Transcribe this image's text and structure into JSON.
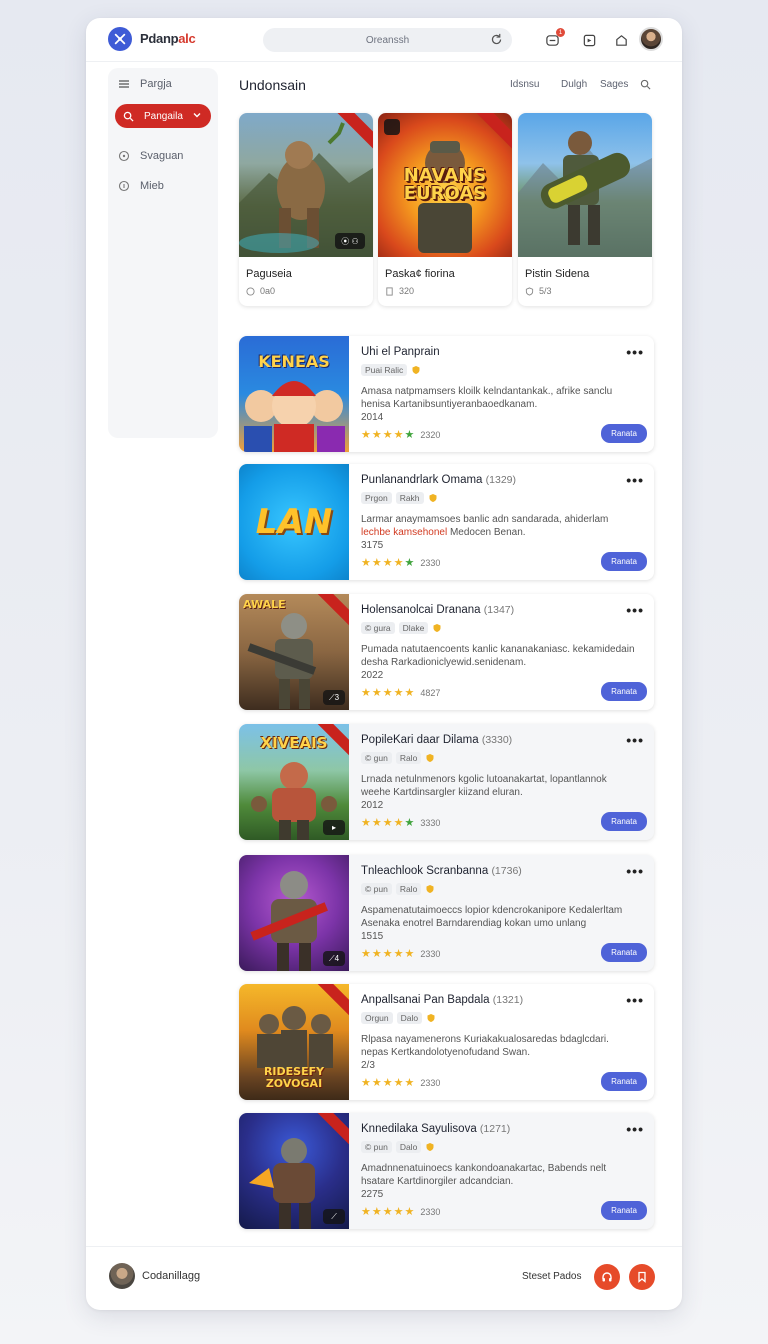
{
  "header": {
    "brand_main": "Pdanp",
    "brand_accent": "alc",
    "search_placeholder": "Oreanssh",
    "notif_count": "1"
  },
  "sidebar": {
    "items": [
      {
        "label": "Pargja",
        "icon": "menu-icon"
      },
      {
        "label": "Pangaila",
        "icon": "search-icon"
      },
      {
        "label": "Svaguan",
        "icon": "chat-icon"
      },
      {
        "label": "Mieb",
        "icon": "info-icon"
      }
    ]
  },
  "main": {
    "title": "Undonsain",
    "links": [
      "Idsnsu",
      "Dulgh",
      "Sages"
    ]
  },
  "featured": [
    {
      "title": "Paguseia",
      "meta": "0a0",
      "chip": "⦿ ⚇"
    },
    {
      "title": "Paska¢ fiorina",
      "meta": "320",
      "art_text": "NAVANS EUROAS"
    },
    {
      "title": "Pistin Sidena",
      "meta": "5/3"
    }
  ],
  "rows": [
    {
      "title": "Uhi el Panprain",
      "year": "",
      "tags": [
        "Puai Ralic"
      ],
      "desc_a": "Amasa natpmamsers kloilk kelndantankak., afrike sanclu henisa Kartanibsuntiyeranbaoedkanam.",
      "desc_hl": "",
      "desc_b": "",
      "year_line": "2014",
      "rating_green": 1,
      "count": "2320",
      "button": "Ranata",
      "art_text": "KENEAS"
    },
    {
      "title": "Punlanandrlark Omama",
      "year": "(1329)",
      "tags": [
        "Prgon",
        "Rakh"
      ],
      "desc_a": "Larmar anaymamsoes banlic adn sandarada, ahiderlam",
      "desc_hl": "lechbe kamsehonel",
      "desc_b": "Medocen Benan.",
      "year_line": "3175",
      "rating_green": 1,
      "count": "2330",
      "button": "Ranata",
      "art_text": "LAN"
    },
    {
      "title": "Holensanolcai Dranana",
      "year": "(1347)",
      "tags": [
        "© gura",
        "Dlake"
      ],
      "desc_a": "Pumada natutaencoents kanlic kananakaniasc. kekamidedain desha Rarkadioniclyewid.senidenam.",
      "desc_hl": "",
      "desc_b": "",
      "year_line": "2022",
      "rating_green": 0,
      "count": "4827",
      "button": "Ranata",
      "art_text": "AWALE"
    },
    {
      "title": "PopileKari daar Dilama",
      "year": "(3330)",
      "tags": [
        "© gun",
        "Ralo"
      ],
      "desc_a": "Lrnada netulnmenors kgolic lutoanakartat, lopantlannok weehe Kartdinsargler kiizand eluran.",
      "desc_hl": "",
      "desc_b": "",
      "year_line": "2012",
      "rating_green": 1,
      "count": "3330",
      "button": "Ranata",
      "art_text": "XIVEAIS"
    },
    {
      "title": "Tnleachlook Scranbanna",
      "year": "(1736)",
      "tags": [
        "© pun",
        "Ralo"
      ],
      "desc_a": "Aspamenatutaimoeccs lopior kdencrokanipore Kedalerltam Asenaka enotrel Barndarendiag kokan umo unlang",
      "desc_hl": "",
      "desc_b": "",
      "year_line": "1515",
      "rating_green": 0,
      "count": "2330",
      "button": "Ranata",
      "art_text": ""
    },
    {
      "title": "Anpallsanai Pan Bapdala",
      "year": "(1321)",
      "tags": [
        "Orgun",
        "Dalo"
      ],
      "desc_a": "Rlpasa nayamenerons Kuriakakualosaredas bdaglcdari. nepas Kertkandolotyenofudand Swan.",
      "desc_hl": "",
      "desc_b": "",
      "year_line": "2/3",
      "rating_green": 0,
      "count": "2330",
      "button": "Ranata",
      "art_text": "RIDESEFY ZOVOGAI"
    },
    {
      "title": "Knnedilaka Sayulisova",
      "year": "(1271)",
      "tags": [
        "© pun",
        "Dalo"
      ],
      "desc_a": "Amadnnenatuinoecs kankondoanakartac, Babends nelt hsatare Kartdinorgiler adcandcian.",
      "desc_hl": "",
      "desc_b": "",
      "year_line": "2275",
      "rating_green": 0,
      "count": "2330",
      "button": "Ranata",
      "art_text": ""
    }
  ],
  "footer": {
    "name": "Codanillagg",
    "link": "Steset Pados"
  },
  "colors": {
    "accent_blue": "#4f63d8",
    "accent_red": "#cf2a24",
    "star": "#f0b323"
  }
}
